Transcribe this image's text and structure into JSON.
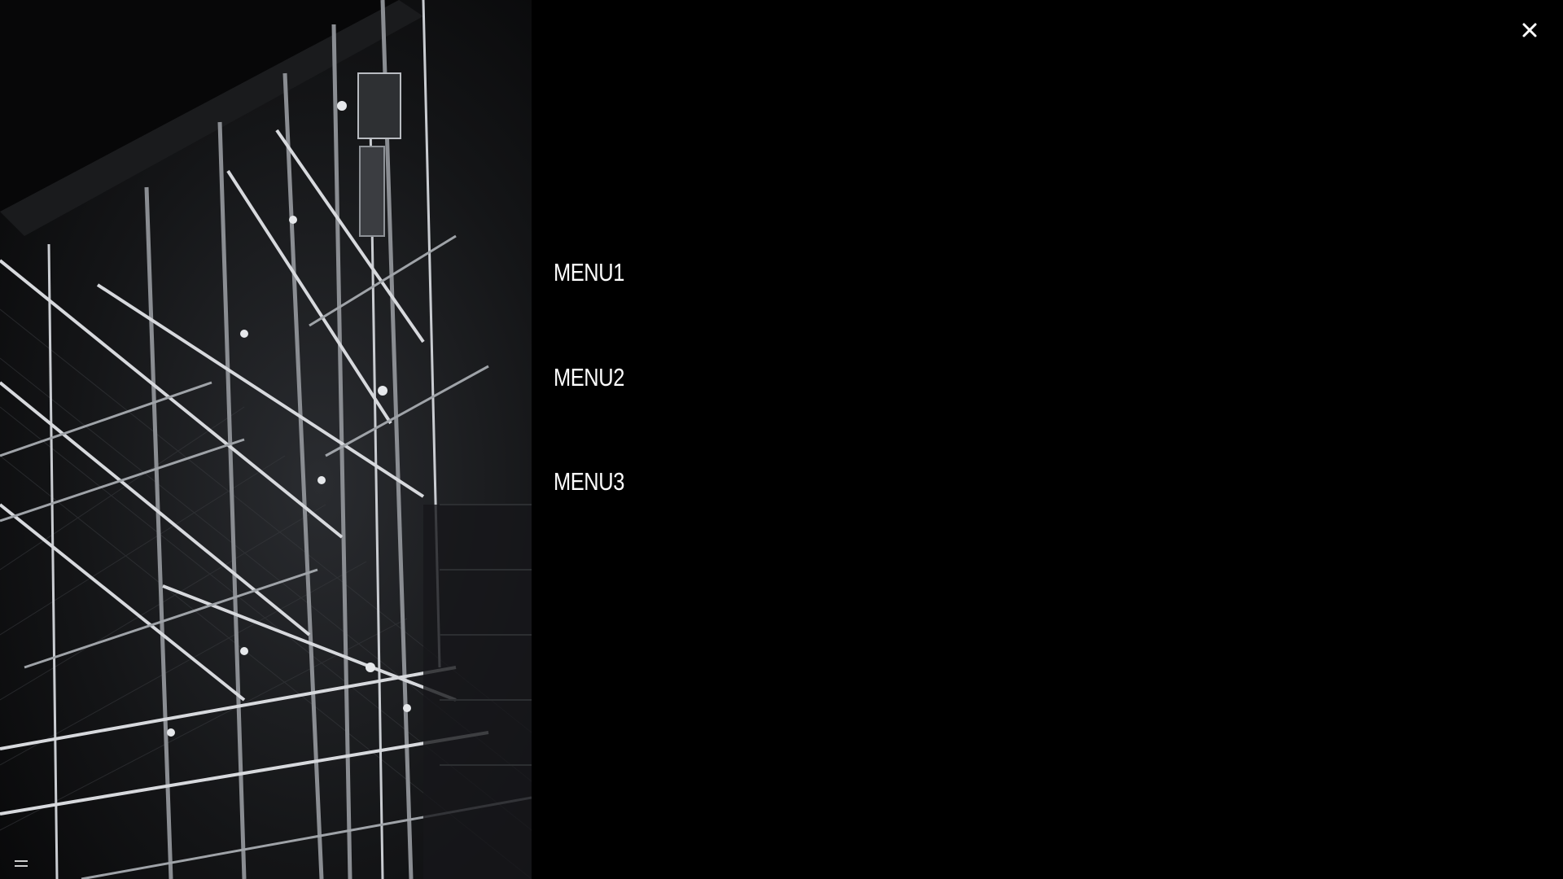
{
  "menu": {
    "items": [
      {
        "label": "MENU1"
      },
      {
        "label": "MENU2"
      },
      {
        "label": "MENU3"
      }
    ]
  },
  "controls": {
    "close_icon": "close-icon",
    "hamburger_icon": "hamburger-menu-icon"
  },
  "colors": {
    "background": "#000000",
    "menu_text": "#ffffff",
    "icon": "#ffffff"
  }
}
